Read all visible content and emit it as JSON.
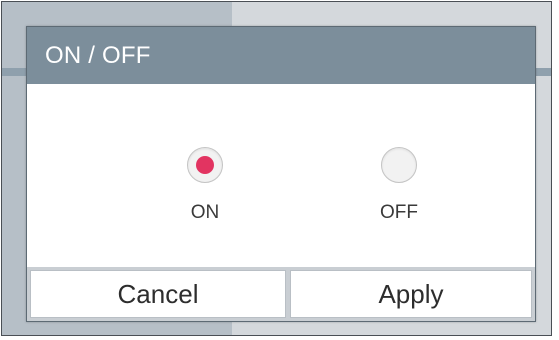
{
  "dialog": {
    "title": "ON / OFF",
    "options": [
      {
        "label": "ON",
        "selected": true
      },
      {
        "label": "OFF",
        "selected": false
      }
    ],
    "cancel_label": "Cancel",
    "apply_label": "Apply"
  },
  "colors": {
    "header_bg": "#7c8e9b",
    "selected_dot": "#e23461",
    "footer_bg": "#c9ced3"
  }
}
